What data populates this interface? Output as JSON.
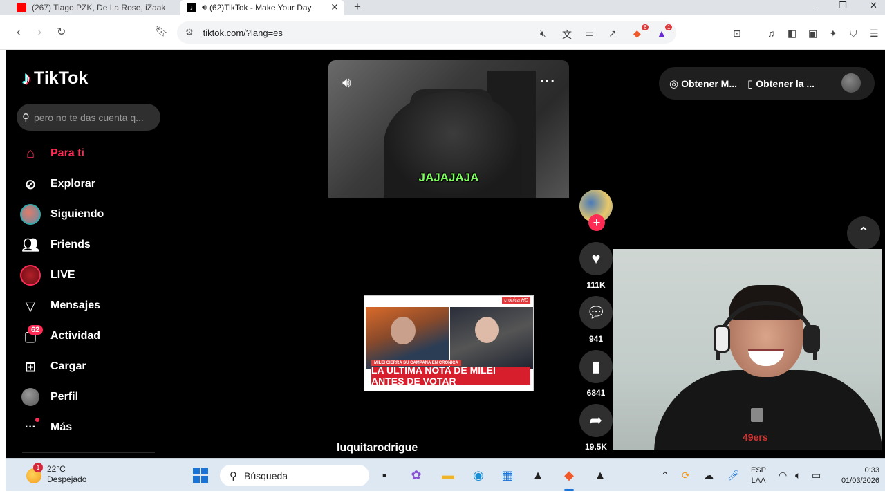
{
  "browser": {
    "tabs": [
      {
        "label": "(267) Tiago PZK, De La Rose, iZaak",
        "active": false
      },
      {
        "label": "(62)TikTok - Make Your Day",
        "active": true
      }
    ],
    "url": "tiktok.com/?lang=es",
    "shield_badge": "6",
    "alert_badge": "1"
  },
  "tiktok": {
    "logo_text": "TikTok",
    "search_placeholder": "pero no te das cuenta q...",
    "nav": [
      {
        "label": "Para ti",
        "icon": "home-icon"
      },
      {
        "label": "Explorar",
        "icon": "compass-icon"
      },
      {
        "label": "Siguiendo",
        "icon": "following-avatar"
      },
      {
        "label": "Friends",
        "icon": "friends-icon"
      },
      {
        "label": "LIVE",
        "icon": "live-avatar"
      },
      {
        "label": "Mensajes",
        "icon": "send-icon"
      },
      {
        "label": "Actividad",
        "icon": "inbox-icon"
      },
      {
        "label": "Cargar",
        "icon": "upload-icon"
      },
      {
        "label": "Perfil",
        "icon": "profile-avatar"
      },
      {
        "label": "Más",
        "icon": "more-icon"
      }
    ],
    "activity_badge": "62",
    "video": {
      "caption": "JAJAJAJA",
      "thumb_banner": "LA ULTIMA NOTA DE MILEI ANTES DE VOTAR",
      "thumb_strap": "MILEI CIERRA SU CAMPAÑA EN CRONICA",
      "thumb_brand": "crónica HD",
      "username": "luquitarodrigue"
    },
    "actions": {
      "likes": "111K",
      "comments": "941",
      "saves": "6841",
      "shares": "19.5K"
    },
    "top_right": {
      "item1": "Obtener M...",
      "item2": "Obtener la ..."
    },
    "webcam_shirt_text": "49ers"
  },
  "taskbar": {
    "weather_badge": "1",
    "temperature": "22°C",
    "condition": "Despejado",
    "search_label": "Búsqueda",
    "lang_line1": "ESP",
    "lang_line2": "LAA",
    "time": "0:33",
    "date": "01/03/2026"
  }
}
